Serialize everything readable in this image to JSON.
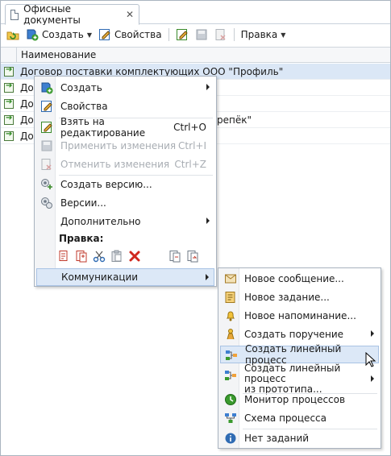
{
  "tab": {
    "title": "Офисные документы",
    "close": "✕"
  },
  "toolbar": {
    "create_label": "Создать",
    "properties_label": "Свойства",
    "edit_label": "Правка"
  },
  "grid": {
    "column_header": "Наименование",
    "rows": [
      "Договор поставки комплектующих ООО \"Профиль\"",
      "До",
      "До",
      "До",
      "До"
    ],
    "row4_tail": "репёк\""
  },
  "context_menu": {
    "items": {
      "create": "Создать",
      "properties": "Свойства",
      "take_edit": "Взять на редактирование",
      "take_edit_shortcut": "Ctrl+O",
      "apply": "Применить изменения",
      "apply_shortcut": "Ctrl+I",
      "cancel": "Отменить изменения",
      "cancel_shortcut": "Ctrl+Z",
      "create_version": "Создать версию...",
      "versions": "Версии...",
      "more": "Дополнительно",
      "edit_header": "Правка:",
      "communications": "Коммуникации"
    }
  },
  "submenu": {
    "items": {
      "new_message": "Новое сообщение...",
      "new_task": "Новое задание...",
      "new_reminder": "Новое напоминание...",
      "create_assignment": "Создать поручение",
      "create_linear": "Создать линейный процесс",
      "create_linear_proto_1": "Создать линейный процесс",
      "create_linear_proto_2": "из прототипа...",
      "process_monitor": "Монитор процессов",
      "process_scheme": "Схема процесса",
      "no_tasks": "Нет заданий"
    }
  },
  "colors": {
    "selection": "#dbe7f6",
    "highlight": "#dce8f7",
    "disabled_text": "#a8adb3"
  }
}
